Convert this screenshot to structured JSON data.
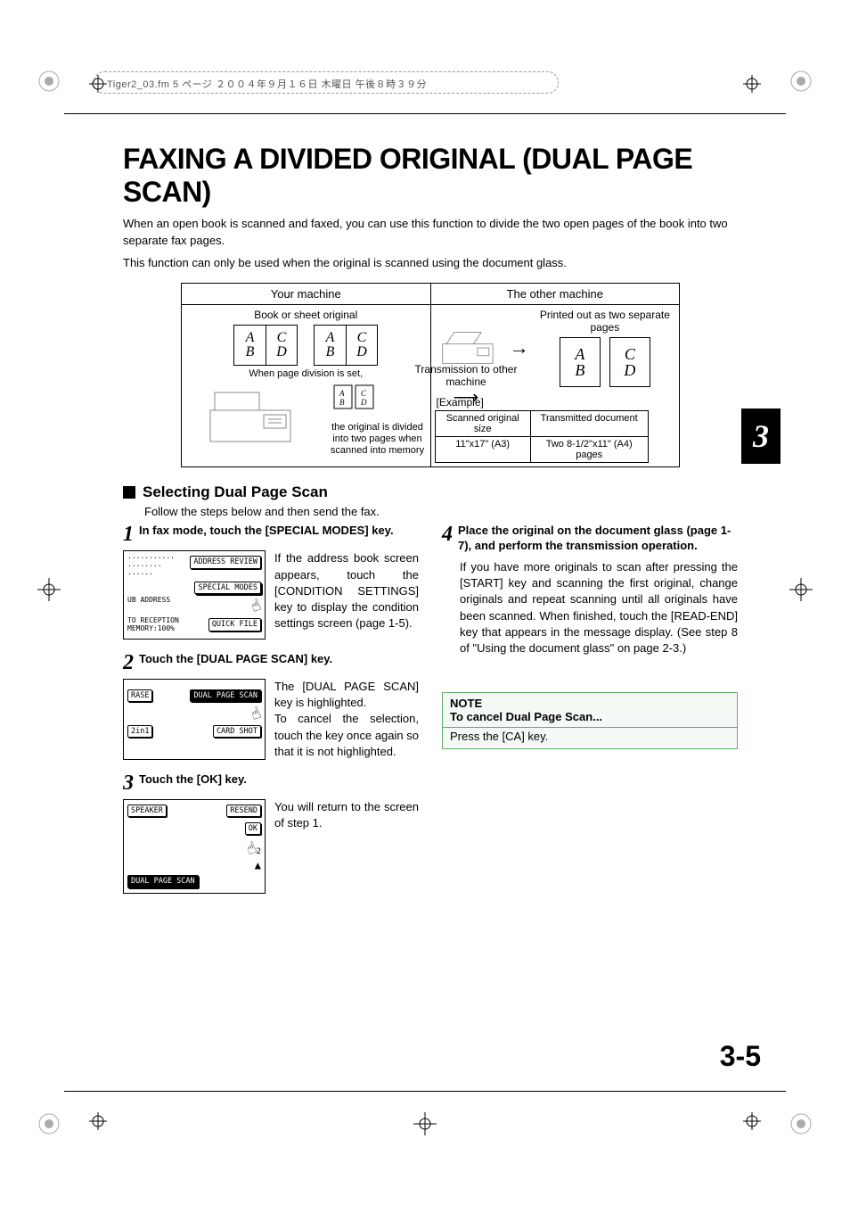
{
  "header_info": "Tiger2_03.fm  5 ページ  ２００４年９月１６日  木曜日  午後８時３９分",
  "title": "FAXING A DIVIDED ORIGINAL  (DUAL PAGE SCAN)",
  "intro1": "When an open book is scanned and faxed, you can use this function to divide the two open pages of the book into two separate fax pages.",
  "intro2": "This function can only be used when the original is scanned using the document glass.",
  "diagram": {
    "your_machine": "Your machine",
    "other_machine": "The other machine",
    "book_label": "Book or sheet original",
    "when_set": "When page division is set,",
    "transmission": "Transmission to other machine",
    "divided": "the original is divided into two pages when scanned into memory",
    "printed_label": "Printed out as two separate pages",
    "example": "[Example]",
    "ex_h1": "Scanned original size",
    "ex_h2": "Transmitted document",
    "ex_v1": "11\"x17\" (A3)",
    "ex_v2": "Two 8-1/2\"x11\" (A4) pages",
    "letters": {
      "a": "A",
      "b": "B",
      "c": "C",
      "d": "D"
    }
  },
  "chapter": "3",
  "section_title": "Selecting Dual Page Scan",
  "follow": "Follow the steps below and then send the fax.",
  "steps": {
    "s1": {
      "num": "1",
      "title": "In fax mode, touch the [SPECIAL MODES] key.",
      "text": "If the address book screen appears, touch the [CONDITION SETTINGS] key to display the condition settings screen (page 1-5).",
      "screen": {
        "btn1": "ADDRESS REVIEW",
        "btn2": "SPECIAL MODES",
        "btn3": "QUICK FILE",
        "left1": "UB ADDRESS",
        "left2": "TO RECEPTION",
        "left3": "MEMORY:100%"
      }
    },
    "s2": {
      "num": "2",
      "title": "Touch the [DUAL PAGE SCAN] key.",
      "text": "The [DUAL PAGE SCAN] key is highlighted.\nTo cancel the selection, touch the key once again so that it is not highlighted.",
      "screen": {
        "btn1": "RASE",
        "btn2": "DUAL PAGE SCAN",
        "btn3": "2in1",
        "btn4": "CARD SHOT"
      }
    },
    "s3": {
      "num": "3",
      "title": "Touch the [OK] key.",
      "text": "You will return to the screen of step 1.",
      "screen": {
        "btn1": "SPEAKER",
        "btn2": "RESEND",
        "btn3": "OK",
        "btn4": "DUAL PAGE SCAN",
        "pg": "2"
      }
    },
    "s4": {
      "num": "4",
      "title": "Place the original on the document glass (page 1-7), and perform the transmission operation.",
      "text": "If you have more originals to scan after pressing the [START] key and scanning the first original, change originals and repeat scanning until all originals have been scanned. When finished, touch the [READ-END] key that appears in the message display. (See step 8 of \"Using the document glass\" on page 2-3.)"
    }
  },
  "note": {
    "title": "NOTE",
    "sub": "To cancel Dual Page Scan...",
    "body": "Press the [CA] key."
  },
  "page_number": "3-5"
}
